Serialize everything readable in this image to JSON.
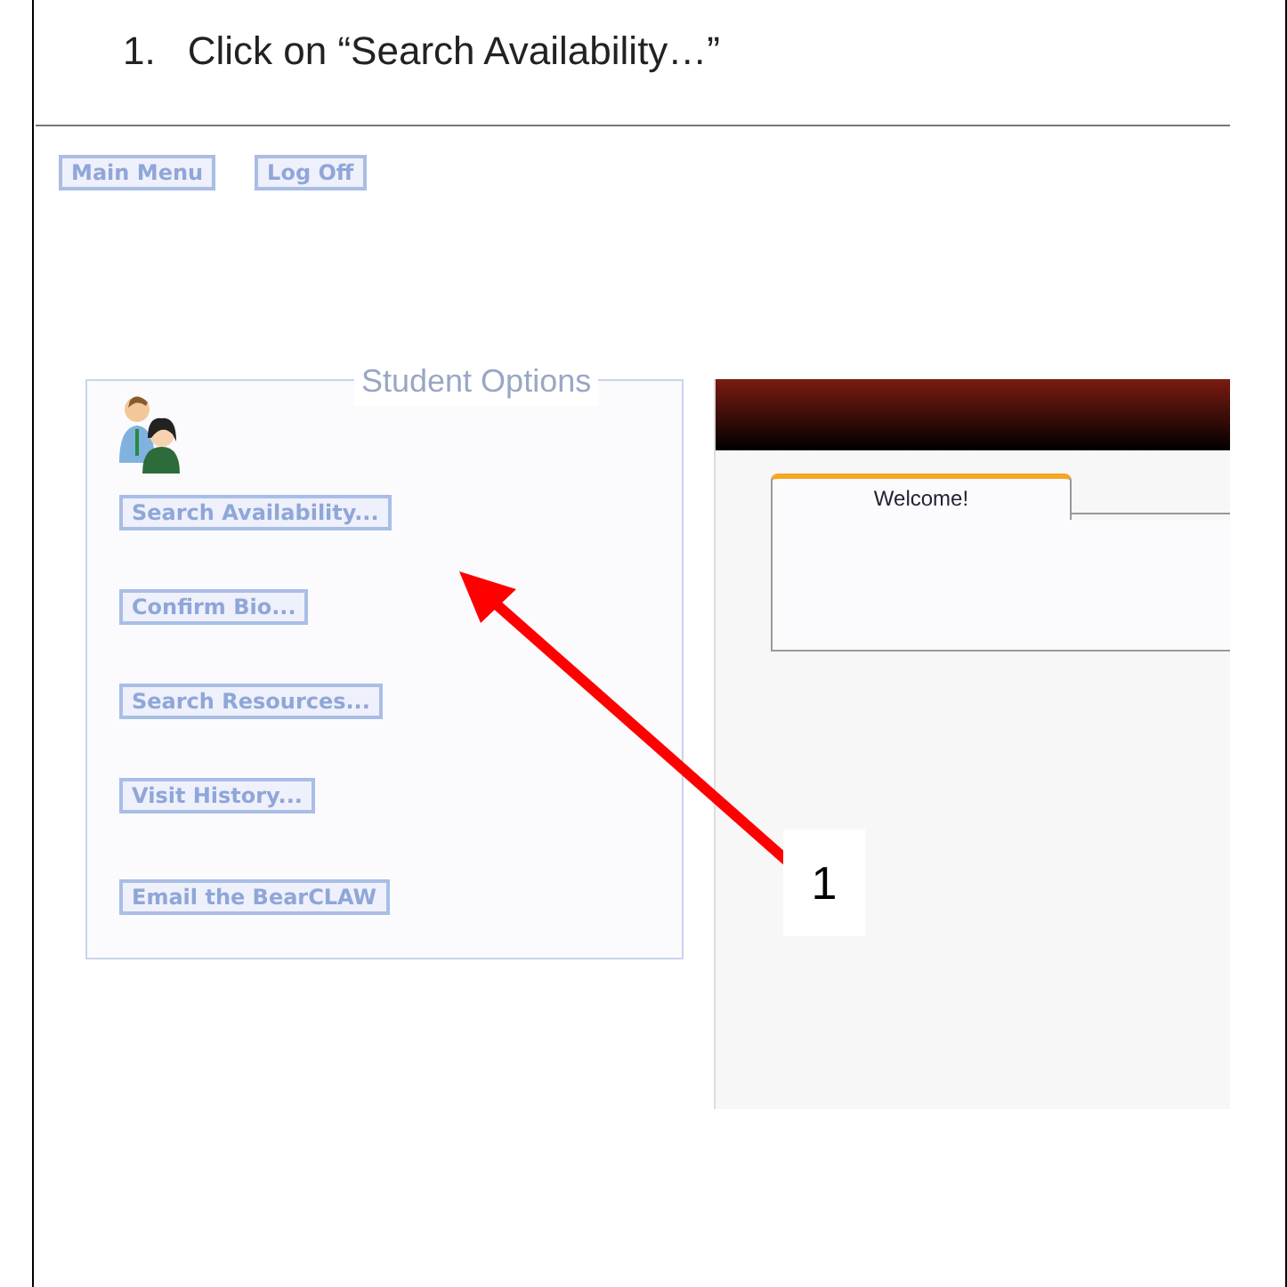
{
  "instruction": {
    "number": "1.",
    "text": "Click on “Search Availability…”"
  },
  "top_buttons": [
    {
      "label": "Main Menu"
    },
    {
      "label": "Log Off"
    }
  ],
  "student_options": {
    "legend": "Student Options",
    "buttons": [
      {
        "label": "Search Availability..."
      },
      {
        "label": "Confirm Bio..."
      },
      {
        "label": "Search Resources..."
      },
      {
        "label": "Visit History..."
      },
      {
        "label": "Email the BearCLAW"
      }
    ]
  },
  "tabs": [
    {
      "label": "Welcome!",
      "selected": true
    }
  ],
  "callout": {
    "label": "1"
  }
}
